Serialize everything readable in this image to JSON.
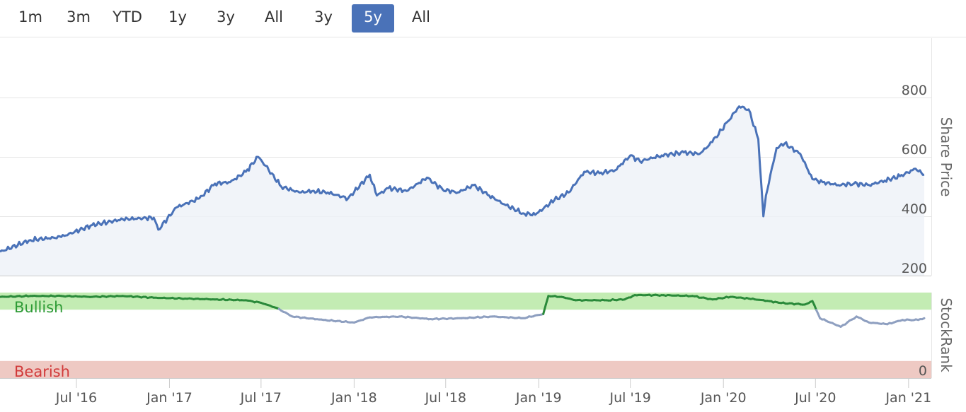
{
  "range_selector": {
    "buttons": [
      {
        "label": "1m",
        "active": false
      },
      {
        "label": "3m",
        "active": false
      },
      {
        "label": "YTD",
        "active": false
      },
      {
        "label": "1y",
        "active": false
      },
      {
        "label": "3y",
        "active": false
      },
      {
        "label": "All",
        "active": false
      },
      {
        "label": "3y",
        "active": false
      },
      {
        "label": "5y",
        "active": true
      },
      {
        "label": "All",
        "active": false
      }
    ]
  },
  "chart_data": [
    {
      "type": "line",
      "ylabel": "Share Price",
      "ylim": [
        200,
        1000
      ],
      "yticks": [
        200,
        400,
        600,
        800
      ],
      "x_tick_labels": [
        "Jul '16",
        "Jan '17",
        "Jul '17",
        "Jan '18",
        "Jul '18",
        "Jan '19",
        "Jul '19",
        "Jan '20",
        "Jul '20",
        "Jan '21"
      ],
      "x_range": [
        "2016-02",
        "2021-02"
      ],
      "grid": true,
      "area_fill": true,
      "series": [
        {
          "x": [
            "2016-02-01",
            "2016-04-01",
            "2016-06-01",
            "2016-08-01",
            "2016-10-01",
            "2016-12-01",
            "2016-12-10",
            "2017-01-15",
            "2017-03-01",
            "2017-04-01",
            "2017-05-01",
            "2017-06-01",
            "2017-06-25",
            "2017-07-10",
            "2017-08-10",
            "2017-09-15",
            "2017-10-10",
            "2017-11-10",
            "2017-12-20",
            "2018-02-01",
            "2018-02-15",
            "2018-03-10",
            "2018-04-15",
            "2018-05-25",
            "2018-06-25",
            "2018-07-25",
            "2018-08-25",
            "2018-09-25",
            "2018-10-25",
            "2018-12-01",
            "2018-12-25",
            "2019-02-01",
            "2019-03-01",
            "2019-04-01",
            "2019-05-01",
            "2019-06-01",
            "2019-07-01",
            "2019-07-20",
            "2019-09-01",
            "2019-10-15",
            "2019-11-15",
            "2019-12-10",
            "2020-01-10",
            "2020-02-01",
            "2020-02-20",
            "2020-03-10",
            "2020-03-20",
            "2020-03-25",
            "2020-04-15",
            "2020-05-01",
            "2020-06-01",
            "2020-06-25",
            "2020-07-15",
            "2020-08-15",
            "2020-09-15",
            "2020-10-15",
            "2020-11-15",
            "2020-12-15",
            "2021-01-15",
            "2021-02-01"
          ],
          "values": [
            280,
            320,
            330,
            370,
            390,
            395,
            355,
            430,
            460,
            510,
            515,
            550,
            600,
            570,
            500,
            480,
            485,
            480,
            460,
            540,
            470,
            495,
            485,
            530,
            490,
            480,
            505,
            470,
            440,
            410,
            405,
            455,
            480,
            550,
            545,
            555,
            605,
            585,
            605,
            615,
            610,
            650,
            720,
            770,
            760,
            660,
            400,
            470,
            630,
            645,
            610,
            525,
            515,
            505,
            510,
            505,
            520,
            535,
            560,
            540
          ]
        }
      ]
    },
    {
      "type": "line",
      "ylabel": "StockRank",
      "ylim": [
        0,
        100
      ],
      "yticks": [
        0
      ],
      "bands": [
        {
          "label": "Bullish",
          "from": 80,
          "to": 100,
          "color": "#c3ecb3"
        },
        {
          "label": "Bearish",
          "from": 0,
          "to": 20,
          "color": "#eec9c3"
        }
      ],
      "series": [
        {
          "x": [
            "2016-02-01",
            "2016-04-01",
            "2016-06-01",
            "2016-08-01",
            "2016-10-01",
            "2016-12-01",
            "2017-02-01",
            "2017-04-01",
            "2017-06-01",
            "2017-07-01",
            "2017-08-01",
            "2017-09-01",
            "2017-11-01",
            "2018-01-01",
            "2018-02-01",
            "2018-04-01",
            "2018-06-01",
            "2018-08-01",
            "2018-10-01",
            "2018-12-01",
            "2019-01-10",
            "2019-01-20",
            "2019-02-15",
            "2019-03-15",
            "2019-05-15",
            "2019-06-20",
            "2019-07-10",
            "2019-09-01",
            "2019-11-01",
            "2019-12-10",
            "2020-01-15",
            "2020-02-20",
            "2020-04-01",
            "2020-04-20",
            "2020-06-10",
            "2020-06-25",
            "2020-07-10",
            "2020-08-20",
            "2020-09-20",
            "2020-10-15",
            "2020-11-20",
            "2020-12-20",
            "2021-01-20",
            "2021-02-01"
          ],
          "values": [
            95,
            96,
            96,
            95,
            96,
            94,
            93,
            92,
            91,
            88,
            82,
            72,
            68,
            65,
            71,
            72,
            69,
            70,
            72,
            70,
            75,
            96,
            95,
            91,
            91,
            92,
            97,
            97,
            96,
            92,
            95,
            93,
            90,
            88,
            86,
            90,
            70,
            60,
            72,
            65,
            63,
            68,
            68,
            70
          ]
        }
      ]
    }
  ]
}
